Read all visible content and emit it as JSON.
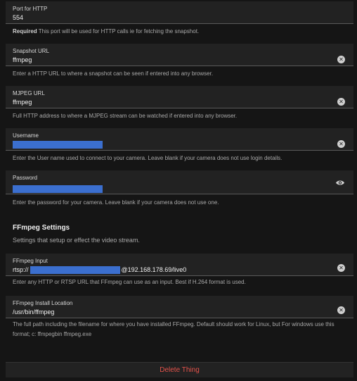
{
  "fields": {
    "port": {
      "label": "Port for HTTP",
      "value": "554"
    },
    "snapshot": {
      "label": "Snapshot URL",
      "value": "ffmpeg"
    },
    "mjpeg": {
      "label": "MJPEG URL",
      "value": "ffmpeg"
    },
    "username": {
      "label": "Username",
      "value": ""
    },
    "password": {
      "label": "Password",
      "value": ""
    },
    "ffmpeg_input": {
      "label": "FFmpeg Input",
      "value_prefix": "rtsp://",
      "value_suffix": "@192.168.178.69/live0"
    },
    "ffmpeg_location": {
      "label": "FFmpeg Install Location",
      "value": "/usr/bin/ffmpeg"
    }
  },
  "help": {
    "port_required": "Required",
    "port": " This port will be used for HTTP calls ie for fetching the snapshot.",
    "snapshot": "Enter a HTTP URL to where a snapshot can be seen if entered into any browser.",
    "mjpeg": "Full HTTP address to where a MJPEG stream can be watched if entered into any browser.",
    "username": "Enter the User name used to connect to your camera. Leave blank if your camera does not use login details.",
    "password": "Enter the password for your camera. Leave blank if your camera does not use one.",
    "ffmpeg_input": "Enter any HTTP or RTSP URL that FFmpeg can use as an input. Best if H.264 format is used.",
    "ffmpeg_location": "The full path including the filename for where you have installed FFmpeg. Default should work for Linux, but For windows use this format; c: ffmpegbin ffmpeg.exe"
  },
  "section": {
    "title": "FFmpeg Settings",
    "subtitle": "Settings that setup or effect the video stream."
  },
  "actions": {
    "delete_label": "Delete Thing"
  },
  "icons": {
    "clear": "clear-icon",
    "visibility": "eye-icon"
  },
  "colors": {
    "redaction": "#3b6fcf",
    "danger": "#e5534b",
    "field_bg": "#222222"
  }
}
